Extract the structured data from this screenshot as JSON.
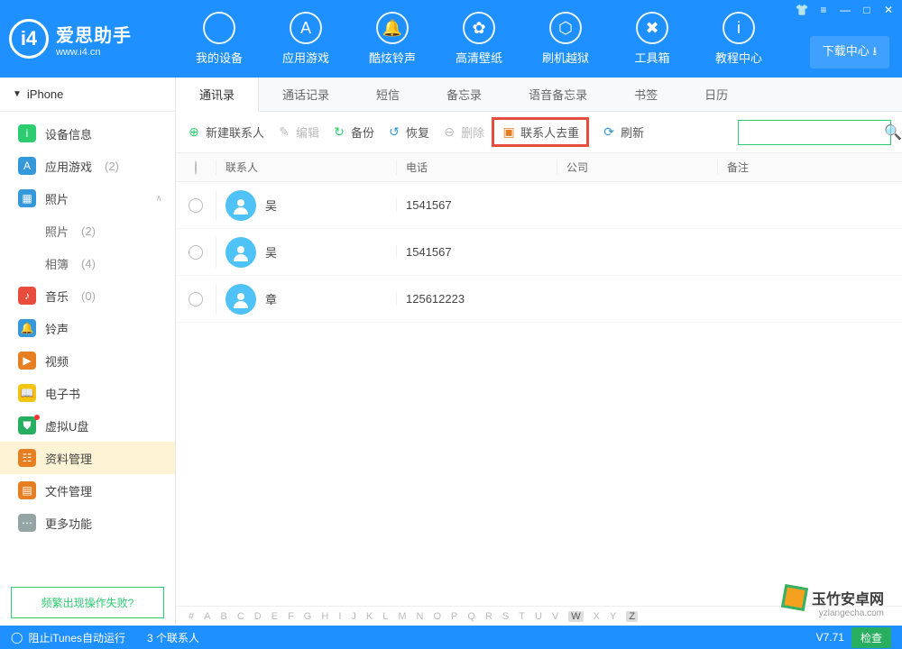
{
  "brand": {
    "name": "爱思助手",
    "url": "www.i4.cn",
    "logo_letter": "i4"
  },
  "download_center": "下载中心",
  "topnav": [
    {
      "label": "我的设备"
    },
    {
      "label": "应用游戏"
    },
    {
      "label": "酷炫铃声"
    },
    {
      "label": "高清壁纸"
    },
    {
      "label": "刷机越狱"
    },
    {
      "label": "工具箱"
    },
    {
      "label": "教程中心"
    }
  ],
  "device_name": "iPhone",
  "sidebar": [
    {
      "label": "设备信息",
      "color": "#2ecc71",
      "icon": "i"
    },
    {
      "label": "应用游戏",
      "count": "(2)",
      "color": "#3498db",
      "icon": "A"
    },
    {
      "label": "照片",
      "color": "#3498db",
      "icon": "▦",
      "expandable": true
    },
    {
      "label": "照片",
      "count": "(2)",
      "sub": true
    },
    {
      "label": "相簿",
      "count": "(4)",
      "sub": true
    },
    {
      "label": "音乐",
      "count": "(0)",
      "color": "#e74c3c",
      "icon": "♪"
    },
    {
      "label": "铃声",
      "color": "#3498db",
      "icon": "🔔"
    },
    {
      "label": "视频",
      "color": "#e67e22",
      "icon": "▶"
    },
    {
      "label": "电子书",
      "color": "#f1c40f",
      "icon": "📖"
    },
    {
      "label": "虚拟U盘",
      "color": "#27ae60",
      "icon": "⛊",
      "dot": true
    },
    {
      "label": "资料管理",
      "color": "#e67e22",
      "icon": "☷",
      "selected": true
    },
    {
      "label": "文件管理",
      "color": "#e67e22",
      "icon": "▤"
    },
    {
      "label": "更多功能",
      "color": "#95a5a6",
      "icon": "⋯"
    }
  ],
  "help_text": "频繁出现操作失败?",
  "tabs": [
    "通讯录",
    "通话记录",
    "短信",
    "备忘录",
    "语音备忘录",
    "书签",
    "日历"
  ],
  "active_tab": 0,
  "toolbar": {
    "new": "新建联系人",
    "edit": "编辑",
    "backup": "备份",
    "restore": "恢复",
    "delete": "删除",
    "dedup": "联系人去重",
    "refresh": "刷新"
  },
  "columns": {
    "name": "联系人",
    "phone": "电话",
    "company": "公司",
    "note": "备注"
  },
  "contacts": [
    {
      "name": "吴",
      "phone": "1541567"
    },
    {
      "name": "吴",
      "phone": "1541567"
    },
    {
      "name": "章",
      "phone": "125612223"
    }
  ],
  "alpha": [
    "#",
    "A",
    "B",
    "C",
    "D",
    "E",
    "F",
    "G",
    "H",
    "I",
    "J",
    "K",
    "L",
    "M",
    "N",
    "O",
    "P",
    "Q",
    "R",
    "S",
    "T",
    "U",
    "V",
    "W",
    "X",
    "Y",
    "Z"
  ],
  "alpha_on": [
    "W",
    "Z"
  ],
  "status": {
    "itunes": "阻止iTunes自动运行",
    "count": "3 个联系人",
    "version": "V7.71",
    "check": "检查"
  },
  "watermark": {
    "title": "玉竹安卓网",
    "sub": "yzlangecha.com"
  }
}
